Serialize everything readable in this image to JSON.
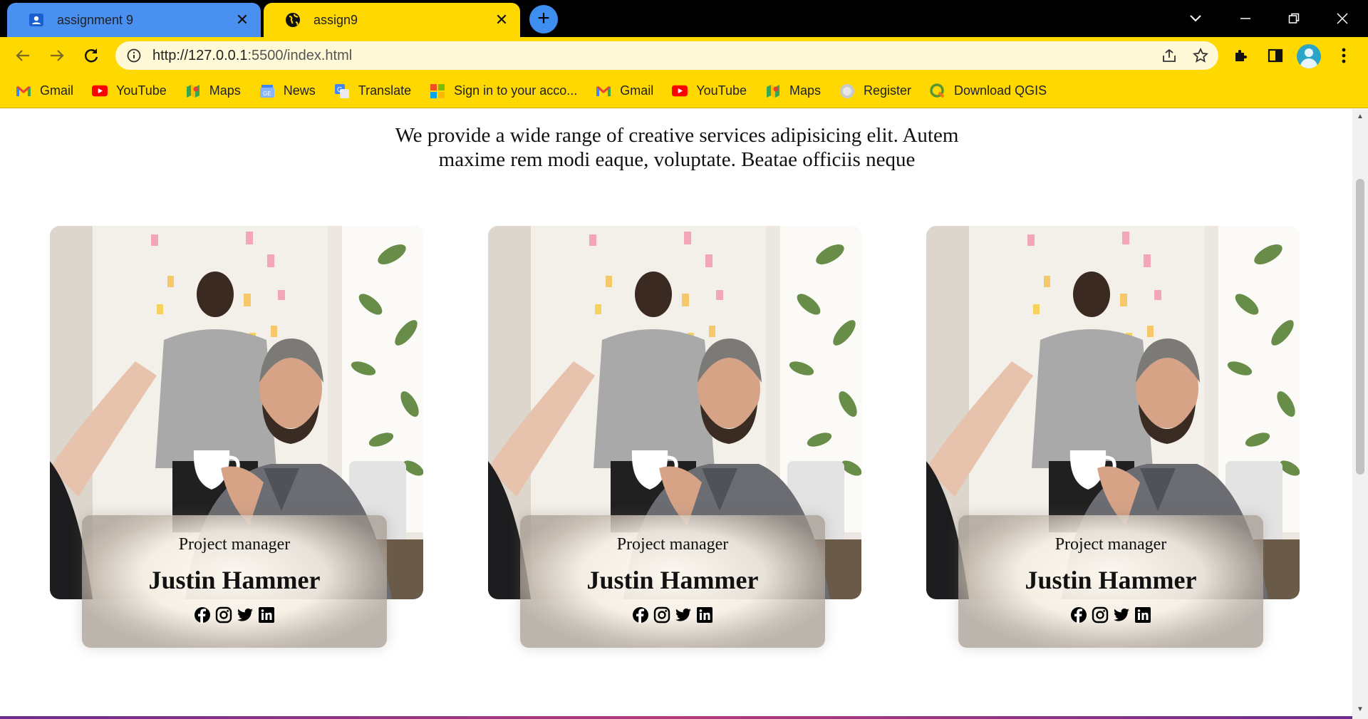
{
  "browser": {
    "tabs": [
      {
        "title": "assignment 9",
        "icon": "profile-card-icon",
        "active": false
      },
      {
        "title": "assign9",
        "icon": "globe-icon",
        "active": true
      }
    ],
    "new_tab_label": "+",
    "url_host": "http://127.0.0.1",
    "url_rest": ":5500/index.html",
    "bookmarks": [
      {
        "label": "Gmail",
        "icon": "gmail-icon"
      },
      {
        "label": "YouTube",
        "icon": "youtube-icon"
      },
      {
        "label": "Maps",
        "icon": "maps-icon"
      },
      {
        "label": "News",
        "icon": "news-icon"
      },
      {
        "label": "Translate",
        "icon": "translate-icon"
      },
      {
        "label": "Sign in to your acco...",
        "icon": "microsoft-icon"
      },
      {
        "label": "Gmail",
        "icon": "gmail-icon"
      },
      {
        "label": "YouTube",
        "icon": "youtube-icon"
      },
      {
        "label": "Maps",
        "icon": "maps-icon"
      },
      {
        "label": "Register",
        "icon": "globe-icon"
      },
      {
        "label": "Download QGIS",
        "icon": "qgis-icon"
      }
    ],
    "theme_color": "#ffd800",
    "active_tab_color": "#ffd800",
    "inactive_tab_color": "#4a90f0"
  },
  "page": {
    "intro_line1": "We provide a wide range of creative services adipisicing elit. Autem",
    "intro_line2": "maxime rem modi eaque, voluptate. Beatae officiis neque",
    "team": [
      {
        "role": "Project manager",
        "name": "Justin Hammer",
        "socials": [
          "facebook-icon",
          "instagram-icon",
          "twitter-icon",
          "linkedin-icon"
        ]
      },
      {
        "role": "Project manager",
        "name": "Justin Hammer",
        "socials": [
          "facebook-icon",
          "instagram-icon",
          "twitter-icon",
          "linkedin-icon"
        ]
      },
      {
        "role": "Project manager",
        "name": "Justin Hammer",
        "socials": [
          "facebook-icon",
          "instagram-icon",
          "twitter-icon",
          "linkedin-icon"
        ]
      }
    ]
  }
}
